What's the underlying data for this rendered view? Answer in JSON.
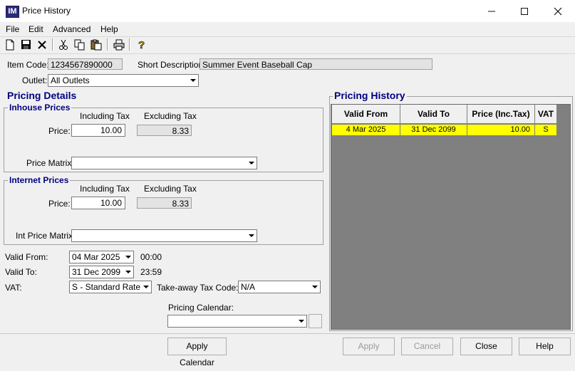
{
  "window": {
    "title": "Price History",
    "icon": "IM"
  },
  "menu": [
    "File",
    "Edit",
    "Advanced",
    "Help"
  ],
  "header": {
    "item_code_label": "Item Code:",
    "item_code": "1234567890000",
    "short_desc_label": "Short Description:",
    "short_desc": "Summer Event Baseball Cap",
    "outlet_label": "Outlet:",
    "outlet": "All Outlets"
  },
  "pricing_details": {
    "title": "Pricing Details",
    "inhouse": {
      "title": "Inhouse Prices",
      "incl_label": "Including Tax",
      "excl_label": "Excluding Tax",
      "price_label": "Price:",
      "price_incl": "10.00",
      "price_excl": "8.33",
      "matrix_label": "Price Matrix:",
      "matrix_value": ""
    },
    "internet": {
      "title": "Internet Prices",
      "incl_label": "Including Tax",
      "excl_label": "Excluding Tax",
      "price_label": "Price:",
      "price_incl": "10.00",
      "price_excl": "8.33",
      "matrix_label": "Int Price Matrix:",
      "matrix_value": ""
    },
    "valid_from_label": "Valid From:",
    "valid_from": "04 Mar 2025",
    "valid_from_time": "00:00",
    "valid_to_label": "Valid To:",
    "valid_to": "31 Dec 2099",
    "valid_to_time": "23:59",
    "vat_label": "VAT:",
    "vat": "S - Standard Rate",
    "takeaway_label": "Take-away Tax Code:",
    "takeaway": "N/A",
    "calendar_label": "Pricing Calendar:",
    "calendar_value": ""
  },
  "pricing_history": {
    "title": "Pricing History",
    "columns": [
      "Valid From",
      "Valid To",
      "Price (Inc.Tax)",
      "VAT"
    ],
    "rows": [
      [
        "4 Mar 2025",
        "31 Dec 2099",
        "10.00",
        "S"
      ]
    ]
  },
  "buttons": {
    "apply_calendar": "Apply Calendar",
    "apply": "Apply",
    "cancel": "Cancel",
    "close": "Close",
    "help": "Help"
  },
  "colors": {
    "accent": "#000080",
    "highlight_row": "#ffff00",
    "grid_bg": "#808080"
  }
}
